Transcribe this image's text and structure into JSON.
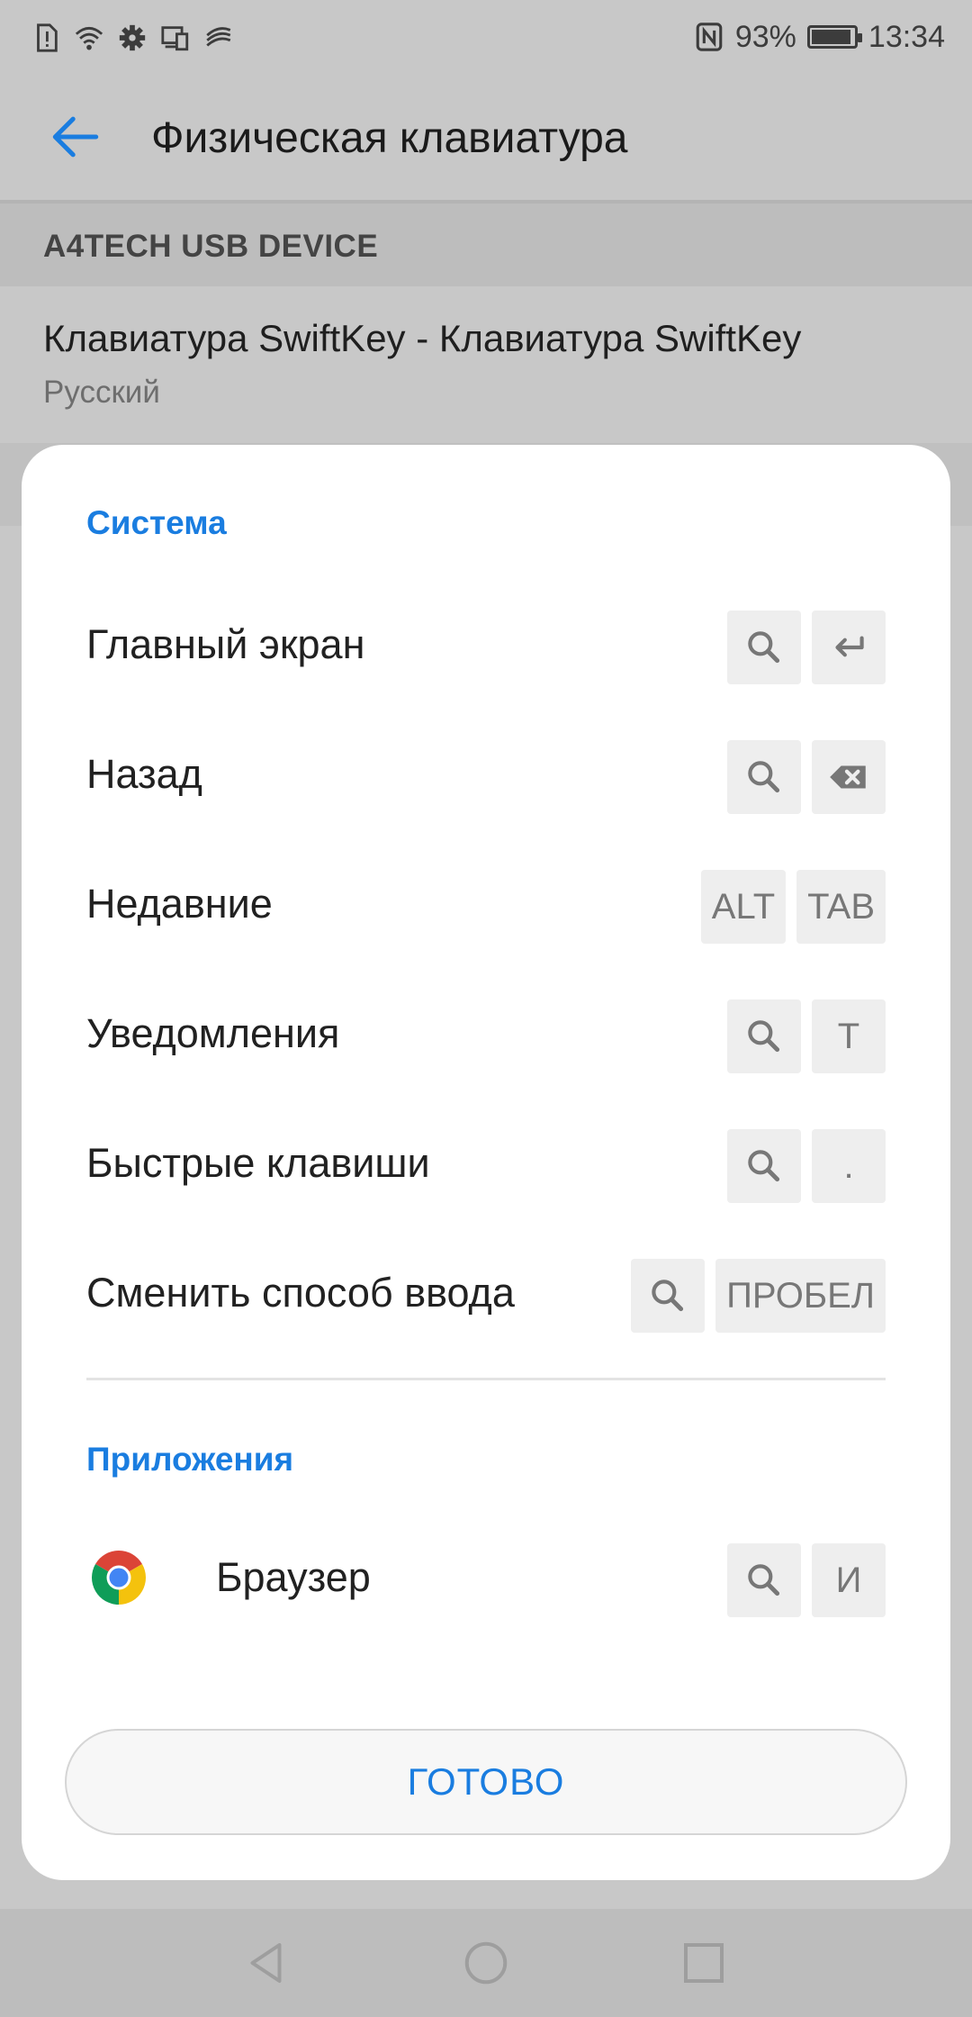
{
  "status_bar": {
    "battery_percent": "93%",
    "battery_level": 0.93,
    "time": "13:34",
    "left_icons": [
      "alert-card-icon",
      "wifi-icon",
      "gear-icon",
      "devices-icon",
      "swiftkey-icon"
    ],
    "right_icons": [
      "nfc-icon",
      "battery-icon"
    ]
  },
  "app_bar": {
    "title": "Физическая клавиатура",
    "back_icon": "arrow-left-icon"
  },
  "device_section": {
    "header": "A4TECH USB DEVICE",
    "keyboard_title": "Клавиатура SwiftKey - Клавиатура SwiftKey",
    "keyboard_language": "Русский"
  },
  "dialog": {
    "system_header": "Система",
    "system_shortcuts": [
      {
        "label": "Главный экран",
        "keys": [
          {
            "icon": "search-icon"
          },
          {
            "icon": "enter-icon"
          }
        ]
      },
      {
        "label": "Назад",
        "keys": [
          {
            "icon": "search-icon"
          },
          {
            "icon": "backspace-icon"
          }
        ]
      },
      {
        "label": "Недавние",
        "keys": [
          {
            "text": "ALT"
          },
          {
            "text": "TAB"
          }
        ]
      },
      {
        "label": "Уведомления",
        "keys": [
          {
            "icon": "search-icon"
          },
          {
            "text": "T"
          }
        ]
      },
      {
        "label": "Быстрые клавиши",
        "keys": [
          {
            "icon": "search-icon"
          },
          {
            "text": "."
          }
        ]
      },
      {
        "label": "Сменить способ ввода",
        "keys": [
          {
            "icon": "search-icon"
          },
          {
            "text": "ПРОБЕЛ"
          }
        ]
      }
    ],
    "apps_header": "Приложения",
    "app_shortcuts": [
      {
        "label": "Браузер",
        "icon": "chrome-icon",
        "keys": [
          {
            "icon": "search-icon"
          },
          {
            "text": "И"
          }
        ]
      }
    ],
    "done_button": "ГОТОВО"
  },
  "nav_bar": {
    "icons": [
      "nav-back-icon",
      "nav-home-icon",
      "nav-recents-icon"
    ]
  },
  "colors": {
    "accent": "#1a7de0",
    "dim_background": "#c8c8c8",
    "dialog_background": "#ffffff",
    "key_background": "#eeeeee"
  }
}
